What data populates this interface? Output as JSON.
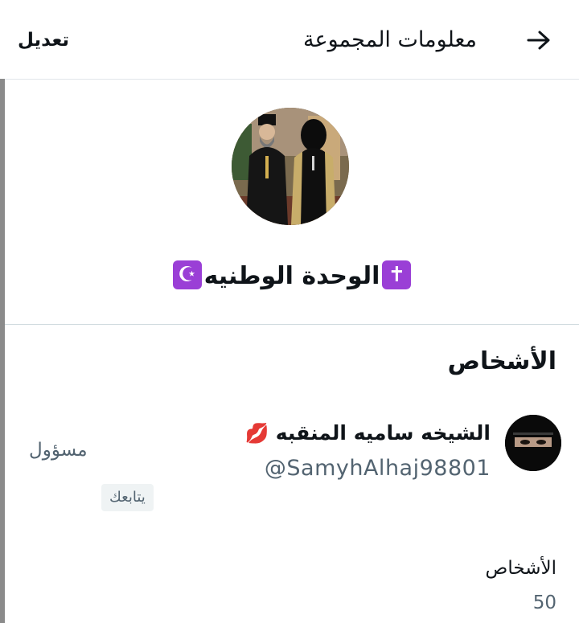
{
  "header": {
    "title": "معلومات المجموعة",
    "edit_label": "تعديل",
    "back_icon": "arrow-right-icon"
  },
  "group": {
    "name": "الوحدة الوطنيه",
    "emoji_left": "✝",
    "emoji_right": "☪"
  },
  "people": {
    "heading": "الأشخاص",
    "members": [
      {
        "name": "الشيخه ساميه المنقبه",
        "name_emoji": "💋",
        "handle": "@SamyhAlhaj98801",
        "role": "مسؤول",
        "follows_badge": "يتابعك"
      }
    ],
    "count_label": "الأشخاص",
    "count_value": "50"
  },
  "colors": {
    "text_primary": "#0f1419",
    "text_secondary": "#536471",
    "emoji_box": "#9a3fd6",
    "divider": "#cfd9de"
  }
}
